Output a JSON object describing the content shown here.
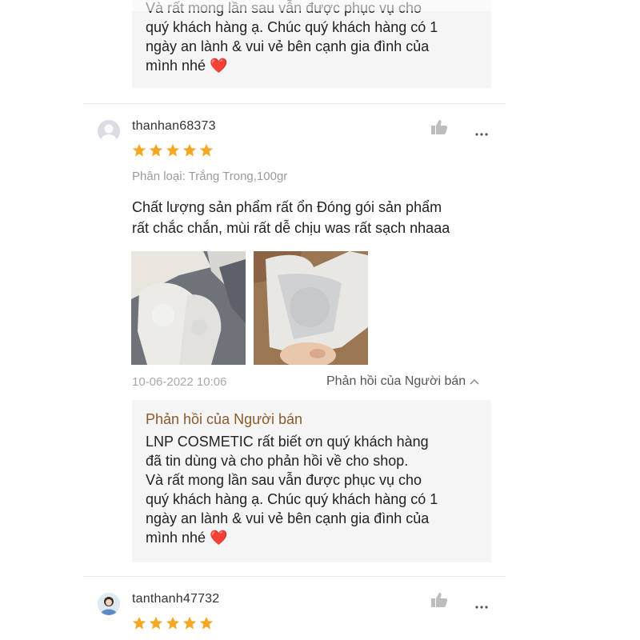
{
  "reviews": [
    {
      "seller_reply": {
        "title": "",
        "lines": [
          "Và rất mong lần sau vẫn được phục vụ cho",
          "quý khách hàng ạ. Chúc quý khách hàng có 1",
          "ngày an lành & vui vẻ bên cạnh gia đình của",
          "mình nhé ❤️"
        ]
      }
    },
    {
      "username": "thanhan68373",
      "rating": 5,
      "variation": "Phân loại: Trắng Trong,100gr",
      "text_lines": [
        "Chất lượng sản phẩm rất ổn  Đóng gói sản phẩm",
        "rất chắc chắn, mùi rất dễ chịu was rất sạch nhaaa"
      ],
      "photos": [
        "review-photo-1",
        "review-photo-2"
      ],
      "date": "10-06-2022 10:06",
      "seller_reply_toggle": "Phản hồi của Người bán",
      "seller_reply": {
        "title": "Phản hồi của Người bán",
        "lines": [
          "LNP COSMETIC rất biết ơn quý khách hàng",
          "đã tin dùng và cho phản hồi về cho shop.",
          "Và rất mong lần sau vẫn được phục vụ cho",
          "quý khách hàng ạ. Chúc quý khách hàng có 1",
          "ngày an lành & vui vẻ bên cạnh gia đình của",
          "mình nhé ❤️"
        ]
      }
    },
    {
      "username": "tanthanh47732",
      "rating": 5
    }
  ],
  "icons": {
    "like": "thumbs-up-icon",
    "more": "more-options-icon",
    "star": "star-icon",
    "chevron": "chevron-up-icon"
  },
  "colors": {
    "star": "#f5a623",
    "seller_title": "#8a5a2b",
    "reply_bg": "#f5f5f5",
    "muted": "#9b9b9b",
    "heart": "#e0232e"
  }
}
